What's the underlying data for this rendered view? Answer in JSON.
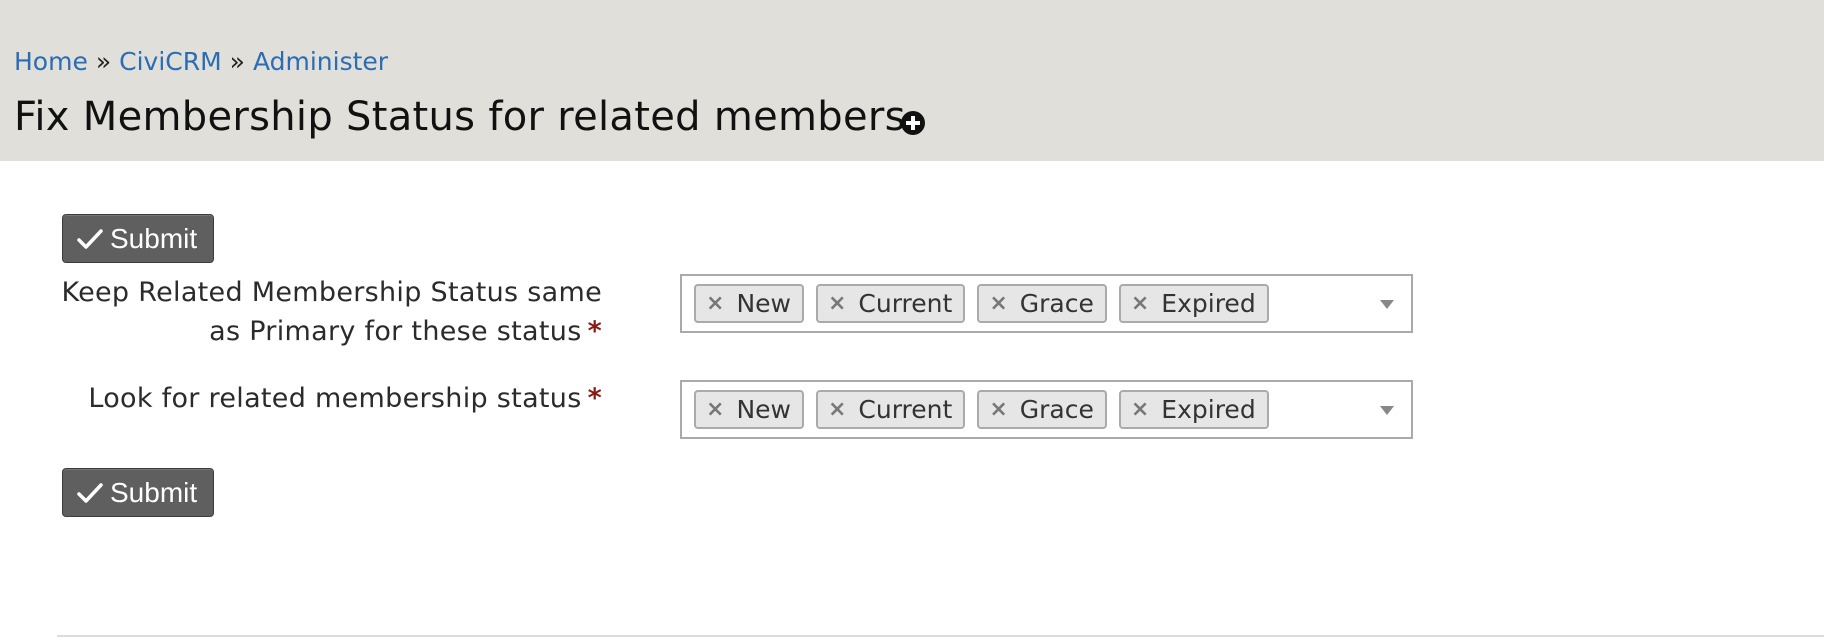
{
  "breadcrumb": {
    "items": [
      "Home",
      "CiviCRM",
      "Administer"
    ],
    "separator": "»"
  },
  "page": {
    "title": "Fix Membership Status for related members."
  },
  "buttons": {
    "submit_label": "Submit"
  },
  "fields": [
    {
      "label_line1": "Keep Related Membership Status same",
      "label_line2": "as Primary for these status",
      "required_mark": "*",
      "selected": [
        "New",
        "Current",
        "Grace",
        "Expired"
      ]
    },
    {
      "label_line1": "Look for related membership status",
      "required_mark": "*",
      "selected": [
        "New",
        "Current",
        "Grace",
        "Expired"
      ]
    }
  ],
  "icons": {
    "remove_tag": "×"
  },
  "colors": {
    "header_bg": "#e0dfd9",
    "link": "#2a6db5",
    "button_bg": "#5f5f5f",
    "required": "#8a1a14"
  }
}
